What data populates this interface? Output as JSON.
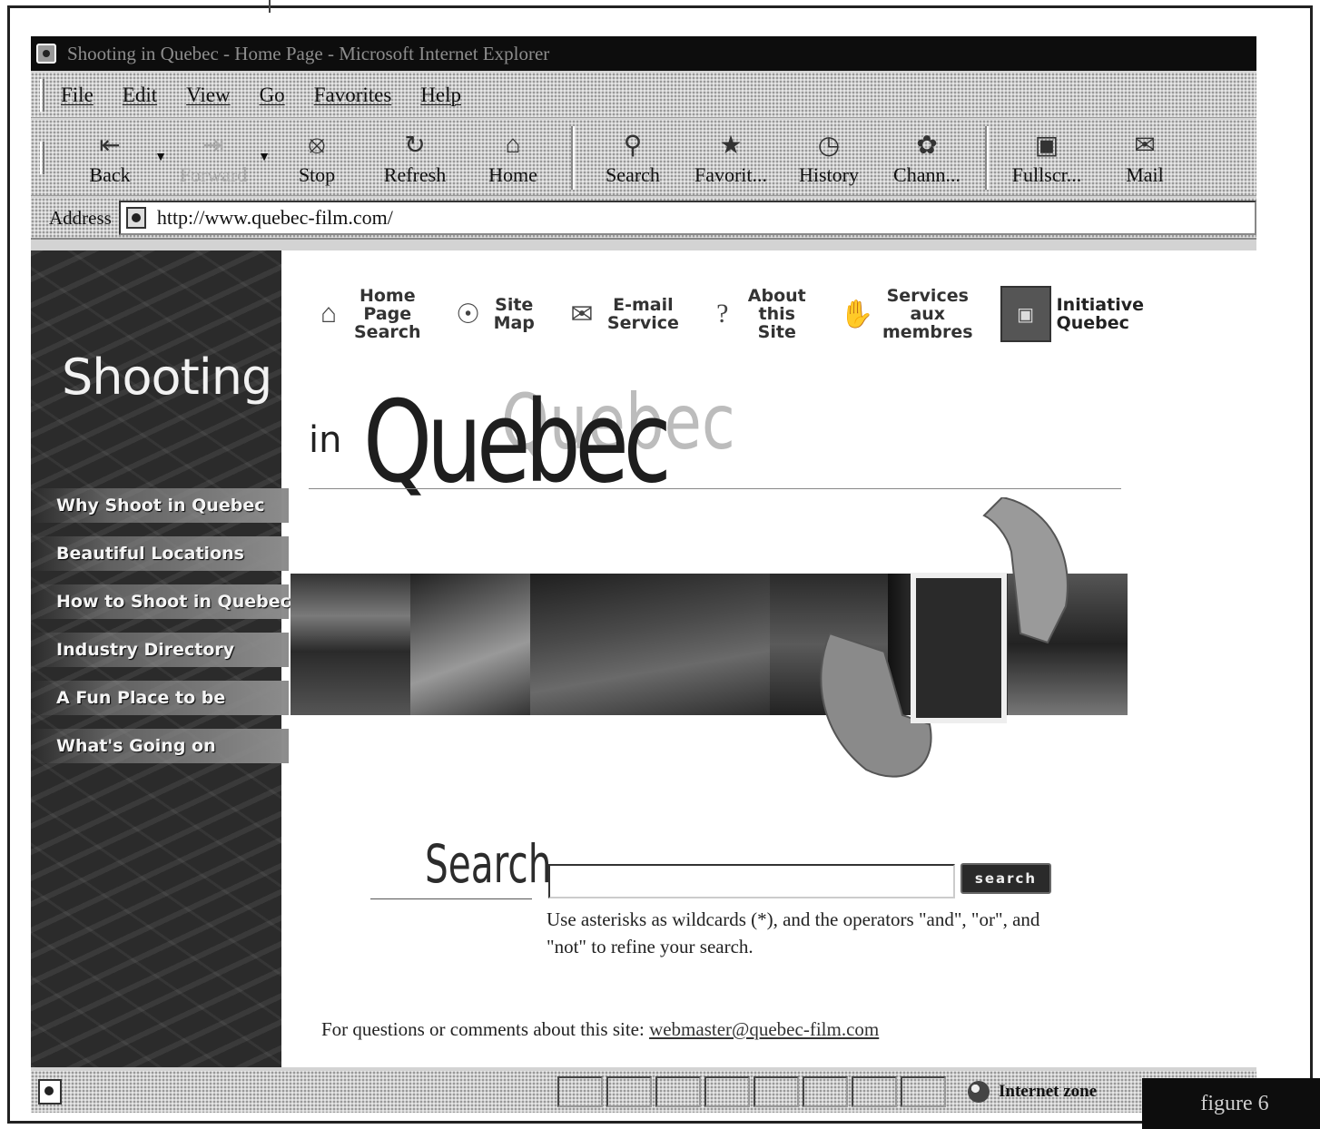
{
  "window": {
    "title": "Shooting in Quebec - Home Page - Microsoft Internet Explorer"
  },
  "menu": [
    "File",
    "Edit",
    "View",
    "Go",
    "Favorites",
    "Help"
  ],
  "toolbar": {
    "back": "Back",
    "forward": "Forward",
    "stop": "Stop",
    "refresh": "Refresh",
    "home": "Home",
    "search": "Search",
    "favorites": "Favorit...",
    "history": "History",
    "channels": "Chann...",
    "fullscreen": "Fullscr...",
    "mail": "Mail"
  },
  "address": {
    "label": "Address",
    "url": "http://www.quebec-film.com/"
  },
  "sidebar": {
    "title": "Shooting",
    "links": [
      "Why Shoot in Quebec",
      "Beautiful Locations",
      "How to Shoot in Quebec",
      "Industry Directory",
      "A Fun Place to be",
      "What's Going on"
    ]
  },
  "topnav": {
    "home_search": "Home\nPage\nSearch",
    "site_map": "Site\nMap",
    "email": "E-mail\nService",
    "about": "About\nthis Site",
    "services": "Services\naux\nmembres",
    "initiative": "Initiative\nQuebec"
  },
  "logo": {
    "in": "in",
    "main": "Quebec",
    "ghost": "Quebec"
  },
  "search": {
    "heading": "Search",
    "value": "",
    "button": "search",
    "hint": "Use asterisks as wildcards (*), and the operators \"and\", \"or\", and \"not\" to refine your search."
  },
  "footer": {
    "text": "For questions or comments about this site: ",
    "email": "webmaster@quebec-film.com"
  },
  "status": {
    "zone": "Internet zone"
  },
  "figure": {
    "label": "figure 6"
  }
}
